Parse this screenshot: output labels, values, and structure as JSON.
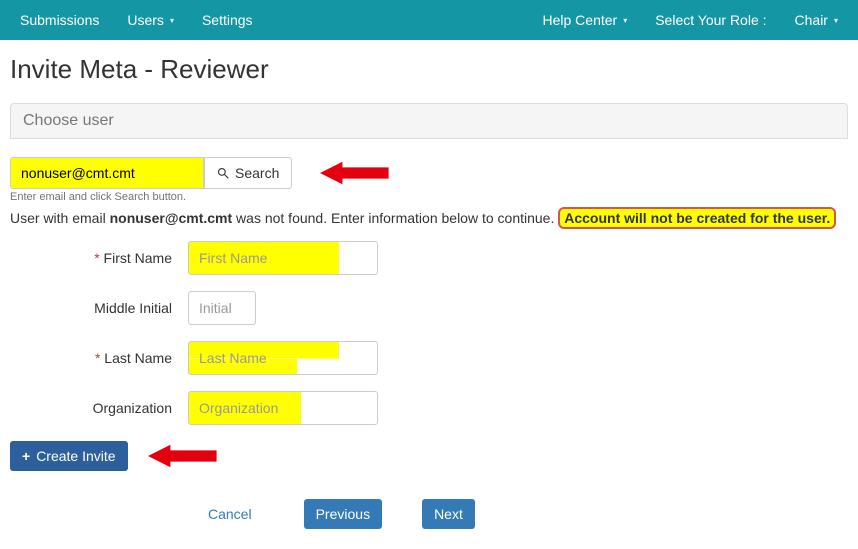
{
  "nav": {
    "left": {
      "submissions": "Submissions",
      "users": "Users",
      "settings": "Settings"
    },
    "right": {
      "help_center": "Help Center",
      "role_label": "Select Your Role :",
      "role_value": "Chair"
    }
  },
  "page_title": "Invite Meta - Reviewer",
  "panel_title": "Choose user",
  "search": {
    "value": "nonuser@cmt.cmt",
    "button": "Search",
    "help": "Enter email and click Search button."
  },
  "not_found": {
    "prefix": "User with email ",
    "email_bold": "nonuser@cmt.cmt",
    "suffix": " was not found. Enter information below to continue. ",
    "callout": "Account will not be created for the user."
  },
  "fields": {
    "first_name_label": "First Name",
    "first_name_placeholder": "First Name",
    "middle_initial_label": "Middle Initial",
    "middle_initial_placeholder": "Initial",
    "last_name_label": "Last Name",
    "last_name_placeholder": "Last Name",
    "organization_label": "Organization",
    "organization_placeholder": "Organization"
  },
  "buttons": {
    "create_invite": "Create Invite",
    "cancel": "Cancel",
    "previous": "Previous",
    "next": "Next"
  },
  "icons": {
    "plus": "+",
    "caret": "▾"
  }
}
